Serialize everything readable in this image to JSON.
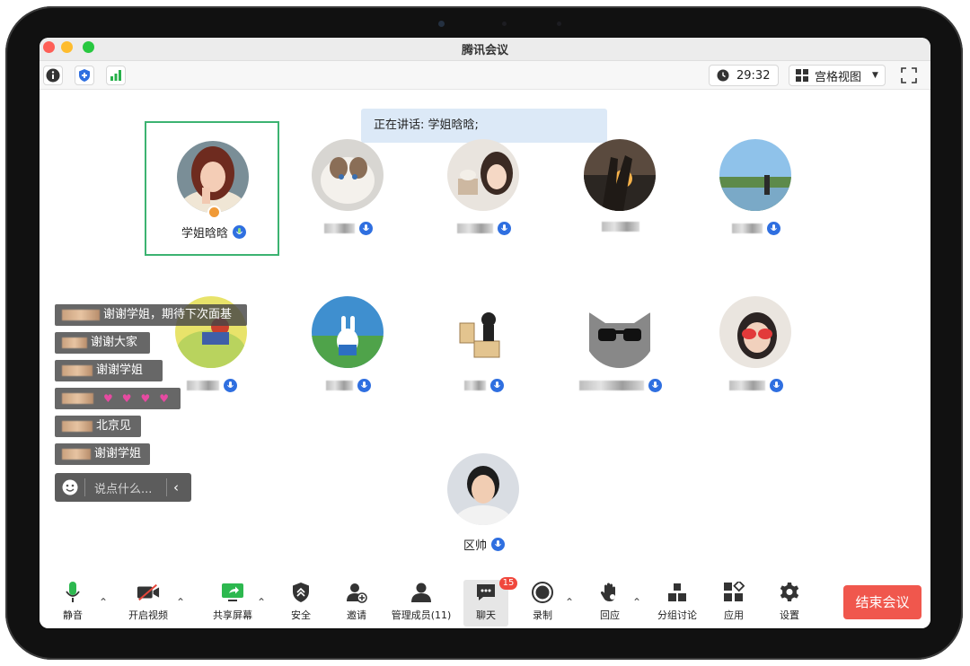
{
  "window": {
    "title": "腾讯会议"
  },
  "topbar": {
    "timer": "29:32",
    "view_label": "宫格视图",
    "icons": [
      "info-icon",
      "security-shield-icon",
      "signal-icon",
      "clock-icon",
      "grid-icon",
      "fullscreen-icon"
    ]
  },
  "speaking": {
    "text": "正在讲话: 学姐晗晗;"
  },
  "participants": [
    {
      "name": "学姐晗晗",
      "active": true,
      "host": true
    },
    {
      "name": ""
    },
    {
      "name": ""
    },
    {
      "name": ""
    },
    {
      "name": ""
    },
    {
      "name": ""
    },
    {
      "name": ""
    },
    {
      "name": ""
    },
    {
      "name": ""
    },
    {
      "name": ""
    },
    {
      "name": "区帅"
    }
  ],
  "chat": {
    "messages": [
      {
        "text": "谢谢学姐，期待下次面基"
      },
      {
        "text": "谢谢大家"
      },
      {
        "text": "谢谢学姐"
      },
      {
        "text": ""
      },
      {
        "text": "北京见"
      },
      {
        "text": "谢谢学姐"
      }
    ],
    "input_placeholder": "说点什么..."
  },
  "toolbar": {
    "mute": "静音",
    "video": "开启视频",
    "share": "共享屏幕",
    "security": "安全",
    "invite": "邀请",
    "members": "管理成员(11)",
    "chat": "聊天",
    "chat_badge": "15",
    "record": "录制",
    "react": "回应",
    "breakout": "分组讨论",
    "apps": "应用",
    "settings": "设置",
    "end": "结束会议"
  },
  "colors": {
    "end_button": "#f0574d",
    "active_border": "#3cb371",
    "mic_badge": "#2f6fe0",
    "chat_badge": "#f0473c"
  }
}
